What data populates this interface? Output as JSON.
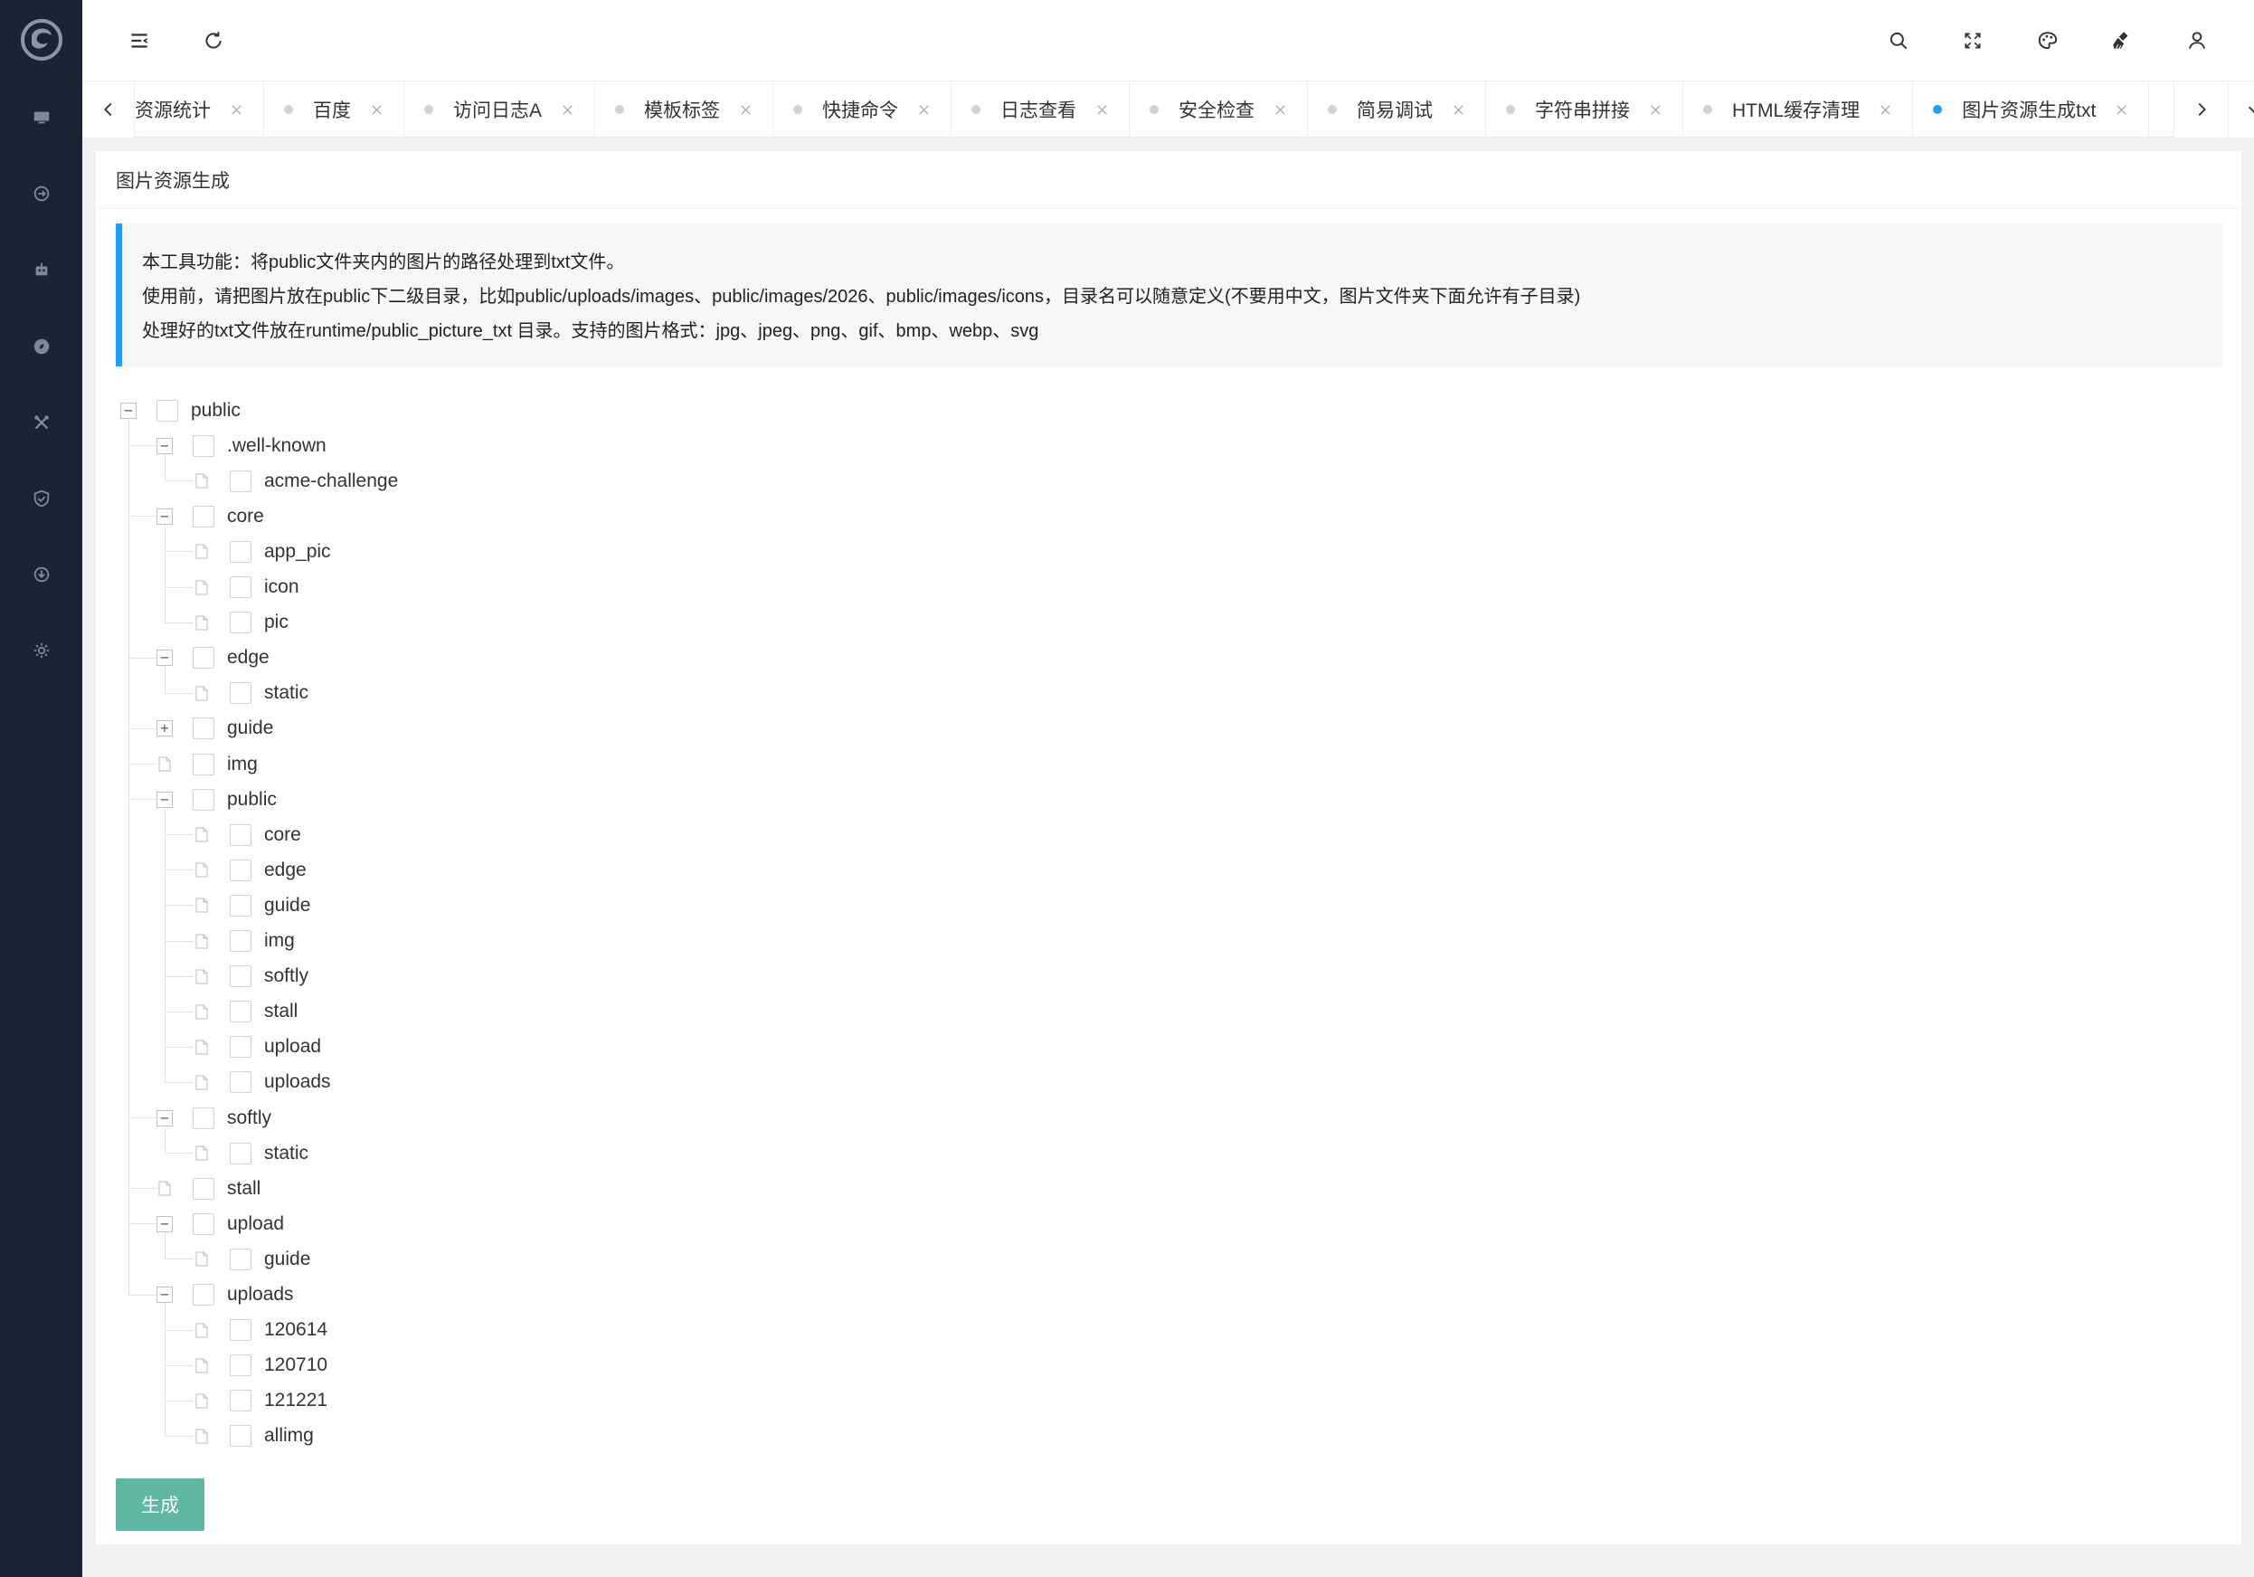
{
  "sidebar": {
    "items": [
      {
        "icon": "monitor-icon"
      },
      {
        "icon": "refresh-cycle-icon"
      },
      {
        "icon": "robot-icon"
      },
      {
        "icon": "compass-icon"
      },
      {
        "icon": "tools-icon"
      },
      {
        "icon": "shield-check-icon"
      },
      {
        "icon": "download-circle-icon"
      },
      {
        "icon": "gear-icon"
      }
    ]
  },
  "header": {
    "left_icons": [
      "menu-collapse-icon",
      "refresh-icon"
    ],
    "right_icons": [
      "search-icon",
      "fullscreen-icon",
      "palette-icon",
      "clean-brush-icon",
      "user-icon"
    ]
  },
  "tabs": [
    {
      "label": "资源统计",
      "active": false
    },
    {
      "label": "百度",
      "active": false
    },
    {
      "label": "访问日志A",
      "active": false
    },
    {
      "label": "模板标签",
      "active": false
    },
    {
      "label": "快捷命令",
      "active": false
    },
    {
      "label": "日志查看",
      "active": false
    },
    {
      "label": "安全检查",
      "active": false
    },
    {
      "label": "简易调试",
      "active": false
    },
    {
      "label": "字符串拼接",
      "active": false
    },
    {
      "label": "HTML缓存清理",
      "active": false
    },
    {
      "label": "图片资源生成txt",
      "active": true
    }
  ],
  "page": {
    "title": "图片资源生成",
    "notice": [
      "本工具功能：将public文件夹内的图片的路径处理到txt文件。",
      "使用前，请把图片放在public下二级目录，比如public/uploads/images、public/images/2026、public/images/icons，目录名可以随意定义(不要用中文，图片文件夹下面允许有子目录)",
      "处理好的txt文件放在runtime/public_picture_txt 目录。支持的图片格式：jpg、jpeg、png、gif、bmp、webp、svg"
    ],
    "generate_label": "生成"
  },
  "tree": [
    {
      "label": "public",
      "level": 0,
      "toggle": "minus"
    },
    {
      "label": ".well-known",
      "level": 1,
      "toggle": "minus"
    },
    {
      "label": "acme-challenge",
      "level": 2,
      "toggle": "leaf"
    },
    {
      "label": "core",
      "level": 1,
      "toggle": "minus"
    },
    {
      "label": "app_pic",
      "level": 2,
      "toggle": "leaf"
    },
    {
      "label": "icon",
      "level": 2,
      "toggle": "leaf"
    },
    {
      "label": "pic",
      "level": 2,
      "toggle": "leaf"
    },
    {
      "label": "edge",
      "level": 1,
      "toggle": "minus"
    },
    {
      "label": "static",
      "level": 2,
      "toggle": "leaf"
    },
    {
      "label": "guide",
      "level": 1,
      "toggle": "plus"
    },
    {
      "label": "img",
      "level": 1,
      "toggle": "leaf"
    },
    {
      "label": "public",
      "level": 1,
      "toggle": "minus"
    },
    {
      "label": "core",
      "level": 2,
      "toggle": "leaf"
    },
    {
      "label": "edge",
      "level": 2,
      "toggle": "leaf"
    },
    {
      "label": "guide",
      "level": 2,
      "toggle": "leaf"
    },
    {
      "label": "img",
      "level": 2,
      "toggle": "leaf"
    },
    {
      "label": "softly",
      "level": 2,
      "toggle": "leaf"
    },
    {
      "label": "stall",
      "level": 2,
      "toggle": "leaf"
    },
    {
      "label": "upload",
      "level": 2,
      "toggle": "leaf"
    },
    {
      "label": "uploads",
      "level": 2,
      "toggle": "leaf"
    },
    {
      "label": "softly",
      "level": 1,
      "toggle": "minus"
    },
    {
      "label": "static",
      "level": 2,
      "toggle": "leaf"
    },
    {
      "label": "stall",
      "level": 1,
      "toggle": "leaf"
    },
    {
      "label": "upload",
      "level": 1,
      "toggle": "minus"
    },
    {
      "label": "guide",
      "level": 2,
      "toggle": "leaf"
    },
    {
      "label": "uploads",
      "level": 1,
      "toggle": "minus"
    },
    {
      "label": "120614",
      "level": 2,
      "toggle": "leaf"
    },
    {
      "label": "120710",
      "level": 2,
      "toggle": "leaf"
    },
    {
      "label": "121221",
      "level": 2,
      "toggle": "leaf"
    },
    {
      "label": "allimg",
      "level": 2,
      "toggle": "leaf"
    }
  ],
  "colors": {
    "sidebar_bg": "#1a2533",
    "accent": "#1e9fff",
    "button": "#5fb8a4"
  }
}
